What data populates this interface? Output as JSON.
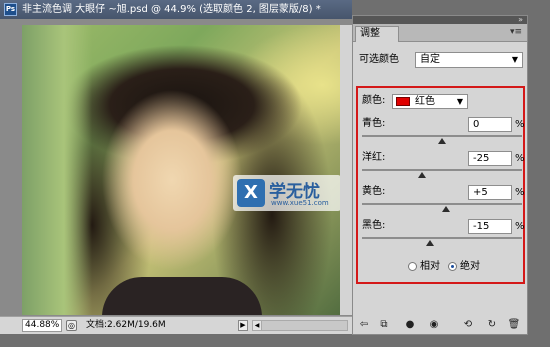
{
  "document": {
    "title": "非主流色调    大眼仔 ~旭.psd @ 44.9% (选取颜色 2, 图层蒙版/8) *",
    "app_icon": "Ps",
    "zoom": "44.88%",
    "doc_size": "文档:2.62M/19.6M"
  },
  "watermark": {
    "logo": "X",
    "name": "学无忧",
    "url": "www.xue51.com"
  },
  "panel": {
    "tab": "调整",
    "preset_label": "可选颜色",
    "preset_value": "自定",
    "color_label": "颜色:",
    "color_value": "红色",
    "color_swatch": "#e00000",
    "rows": [
      {
        "label": "青色:",
        "value": "0",
        "unit": "%",
        "slider": 0
      },
      {
        "label": "洋红:",
        "value": "-25",
        "unit": "%",
        "slider": -25
      },
      {
        "label": "黄色:",
        "value": "+5",
        "unit": "%",
        "slider": 5
      },
      {
        "label": "黑色:",
        "value": "-15",
        "unit": "%",
        "slider": -15
      }
    ],
    "method_relative": "相对",
    "method_absolute": "绝对",
    "method_selected": "绝对"
  },
  "colors": {
    "highlight_border": "#d41818"
  }
}
